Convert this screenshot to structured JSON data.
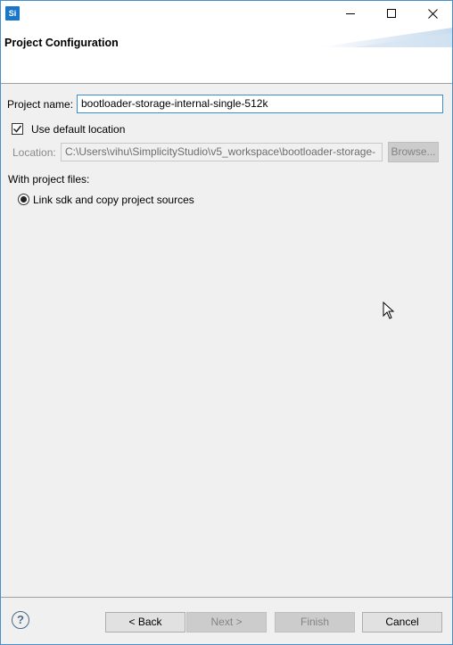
{
  "titlebar": {
    "app_icon": "Si",
    "icons": {
      "minimize": "minimize-icon",
      "maximize": "maximize-icon",
      "close": "close-icon"
    }
  },
  "header": {
    "title": "Project Configuration"
  },
  "form": {
    "project_name_label": "Project name:",
    "project_name_value": "bootloader-storage-internal-single-512k",
    "use_default_location_label": "Use default location",
    "use_default_location_checked": true,
    "location_label": "Location:",
    "location_value": "C:\\Users\\vihu\\SimplicityStudio\\v5_workspace\\bootloader-storage-",
    "browse_label": "Browse...",
    "project_files_label": "With project files:",
    "project_files_option": "Link sdk and copy project sources"
  },
  "footer": {
    "back_label": "< Back",
    "next_label": "Next >",
    "finish_label": "Finish",
    "cancel_label": "Cancel",
    "help_glyph": "?"
  },
  "colors": {
    "accent": "#1976c9",
    "window_border": "#4a90c8",
    "input_focus": "#3c8cd0"
  }
}
